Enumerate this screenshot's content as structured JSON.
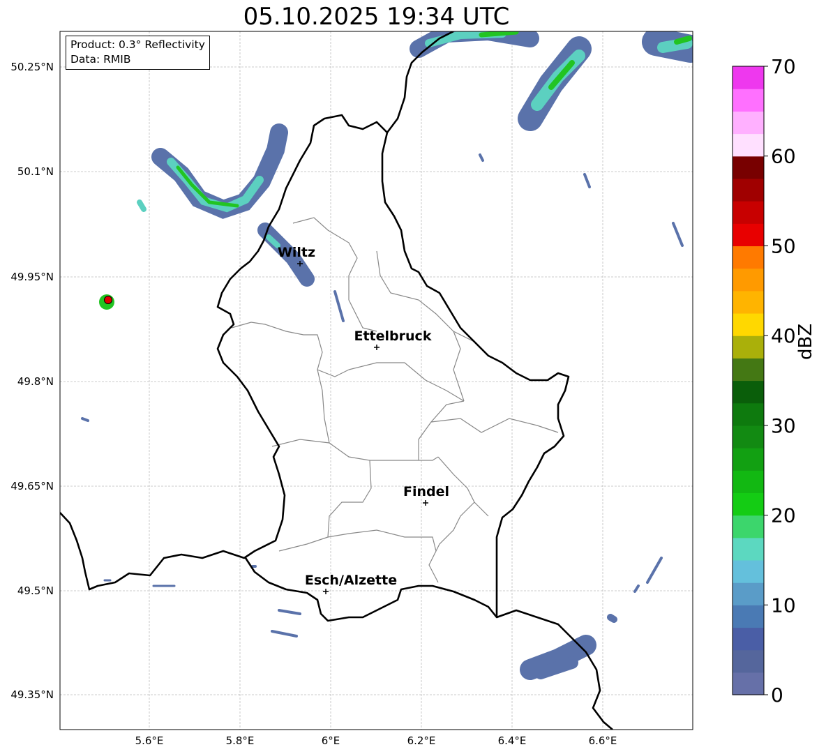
{
  "title": "05.10.2025 19:34 UTC",
  "info": {
    "product": "Product: 0.3° Reflectivity",
    "data": "Data: RMIB"
  },
  "axes": {
    "lon_ticks": [
      "5.6°E",
      "5.8°E",
      "6°E",
      "6.2°E",
      "6.4°E",
      "6.6°E"
    ],
    "lat_ticks": [
      "50.25°N",
      "50.1°N",
      "49.95°N",
      "49.8°N",
      "49.65°N",
      "49.5°N",
      "49.35°N"
    ]
  },
  "cities": [
    {
      "name": "Wiltz"
    },
    {
      "name": "Ettelbruck"
    },
    {
      "name": "Findel"
    },
    {
      "name": "Esch/Alzette"
    }
  ],
  "colorbar": {
    "label": "dBZ",
    "ticks": [
      "0",
      "10",
      "20",
      "30",
      "40",
      "50",
      "60",
      "70"
    ],
    "colors": [
      "#6670a8",
      "#55669c",
      "#4a5ea6",
      "#4a7ab4",
      "#5a9cc8",
      "#64c0dc",
      "#5cd8c0",
      "#3cd66c",
      "#14cc14",
      "#12b812",
      "#12a012",
      "#128a12",
      "#0e7a0e",
      "#0a5e0a",
      "#447814",
      "#aab00a",
      "#ffd800",
      "#ffb400",
      "#ff9a00",
      "#ff7a00",
      "#e80000",
      "#c80000",
      "#a00000",
      "#780000",
      "#ffe0ff",
      "#ffb0ff",
      "#ff70ff",
      "#ee38ee"
    ]
  },
  "colors": {
    "border": "#000000",
    "cantons": "#888888",
    "grid": "#bbbbbb",
    "weak_echo": "#5a72aa",
    "moderate_echo": "#5cd0c0",
    "strong_echo": "#22c422",
    "radar_site": "#e00000"
  }
}
